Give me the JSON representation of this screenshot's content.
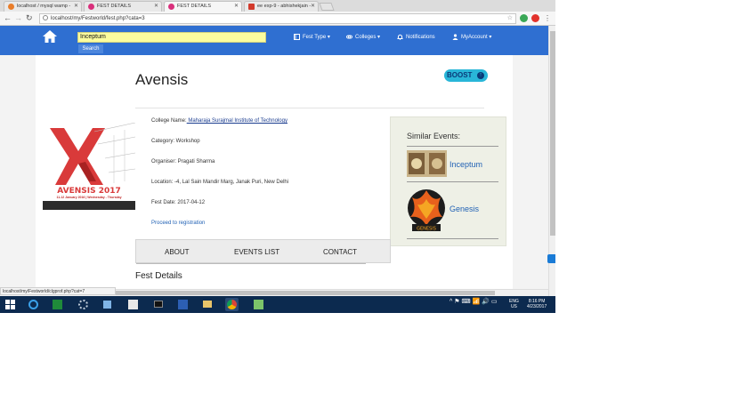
{
  "browser": {
    "tabs": [
      {
        "label": "localhost / mysql wamp -",
        "active": false
      },
      {
        "label": "FEST DETAILS",
        "active": false
      },
      {
        "label": "FEST DETAILS",
        "active": true
      },
      {
        "label": "ee exp-9 - abhishekjain -",
        "active": false
      }
    ],
    "url": "localhost/my/Festworld/fest.php?cata=3"
  },
  "sitenav": {
    "search_value": "Inceptum",
    "search_button": "Search",
    "menu": [
      {
        "label": "Fest Type",
        "icon": "book-icon",
        "caret": true
      },
      {
        "label": "Colleges",
        "icon": "link-icon",
        "caret": true
      },
      {
        "label": "Notifications",
        "icon": "bell-icon",
        "caret": false
      },
      {
        "label": "MyAccount",
        "icon": "user-icon",
        "caret": true
      }
    ]
  },
  "fest": {
    "name": "Avensis",
    "boost_label": "BOOST",
    "college_label": "College Name:",
    "college_value": " Maharaja Surajmal Institute of Technology",
    "category": "Category: Workshop",
    "organiser": "Organiser: Pragati Sharma",
    "location": "Location: -4, Lal Sain Mandir Marg, Janak Puri, New Delhi",
    "date": "Fest Date: 2017-04-12",
    "proceed": "Proceed to registration"
  },
  "poster": {
    "title": "AVENSIS 2017",
    "dates": "11-12 January 2016 | Wednesday - Thursday"
  },
  "similar": {
    "heading": "Similar Events:",
    "items": [
      {
        "label": "Inceptum"
      },
      {
        "label": "Genesis",
        "logo_text": "GENESIS"
      }
    ]
  },
  "tabs": {
    "about": "ABOUT",
    "events": "EVENTS LIST",
    "contact": "CONTACT"
  },
  "section_title": "Fest Details",
  "statusbar": "localhost/my/Festworld/clgprof.php?cat=7",
  "taskbar": {
    "lang": "ENG",
    "region": "US",
    "time": "8:16 PM",
    "date": "4/23/2017"
  },
  "colors": {
    "nav": "#2f6fd1",
    "boost": "#29b6d8",
    "search_highlight": "#fbfc9e",
    "taskbar": "#0c2a4f"
  }
}
